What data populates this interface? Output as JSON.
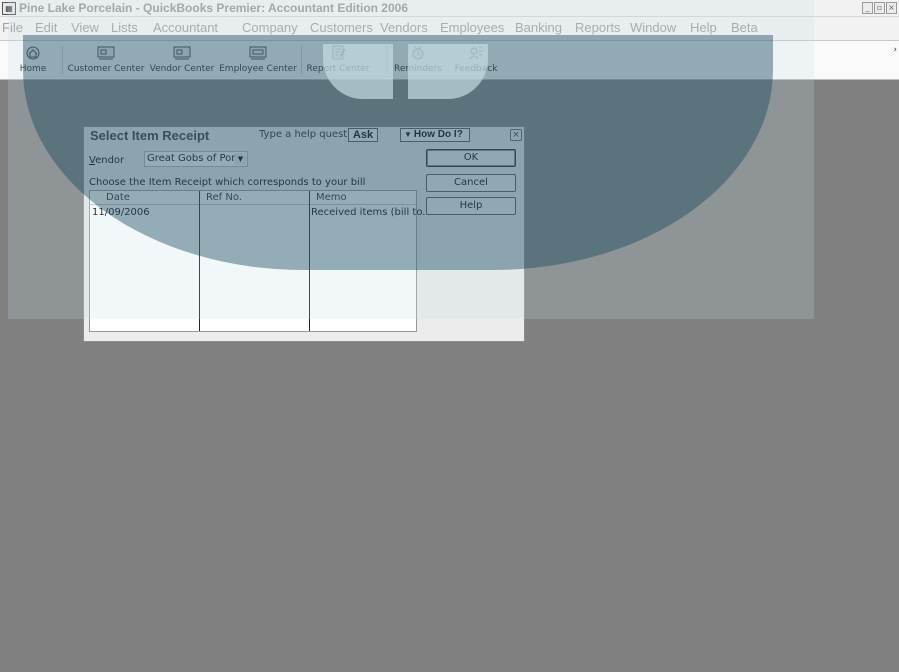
{
  "window": {
    "title": "Pine Lake Porcelain - QuickBooks Premier: Accountant Edition 2006",
    "controls": [
      "minimize-icon",
      "restore-icon",
      "close-icon"
    ]
  },
  "menubar": {
    "items": [
      "File",
      "Edit",
      "View",
      "Lists",
      "Accountant",
      "Company",
      "Customers",
      "Vendors",
      "Employees",
      "Banking",
      "Reports",
      "Window",
      "Help",
      "Beta"
    ]
  },
  "toolbar": {
    "buttons": [
      {
        "label": "Home",
        "icon": "home-icon"
      },
      {
        "label": "Customer Center",
        "icon": "customer-center-icon"
      },
      {
        "label": "Vendor Center",
        "icon": "vendor-center-icon"
      },
      {
        "label": "Employee Center",
        "icon": "employee-center-icon"
      },
      {
        "label": "Report Center",
        "icon": "report-center-icon"
      },
      {
        "label": "Reminders",
        "icon": "reminders-icon"
      },
      {
        "label": "Feedback",
        "icon": "feedback-icon"
      }
    ],
    "more": "›"
  },
  "dialog": {
    "title": "Select Item Receipt",
    "help_prompt": "Type a help question",
    "ask_label": "Ask",
    "howdoi_label": "How Do I?",
    "vendor_label_u": "V",
    "vendor_label_rest": "endor",
    "vendor_value": "Great Gobs of Porce",
    "instruction": "Choose the Item Receipt which corresponds to your bill",
    "columns": [
      "Date",
      "Ref No.",
      "Memo"
    ],
    "rows": [
      {
        "date": "11/09/2006",
        "ref": "",
        "memo": "Received items (bill to..."
      }
    ],
    "buttons": {
      "ok": "OK",
      "cancel": "Cancel",
      "help": "Help"
    }
  },
  "colors": {
    "desktop": "#808080",
    "watermark_teal": "#14465a"
  }
}
